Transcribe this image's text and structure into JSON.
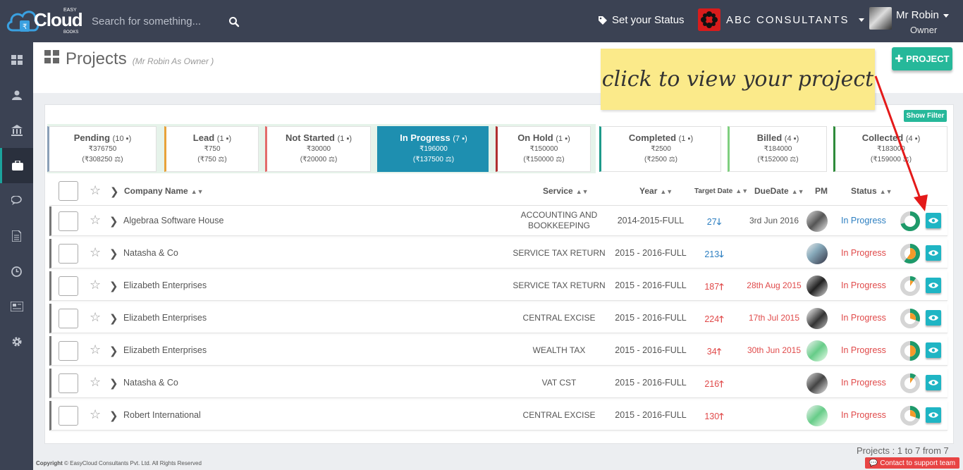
{
  "brand": {
    "logo_text": "Cloud",
    "logo_top": "EASY",
    "logo_bottom": "BOOKS"
  },
  "search": {
    "placeholder": "Search for something..."
  },
  "topbar": {
    "status_label": "Set your Status",
    "company": "ABC CONSULTANTS",
    "user_name": "Mr Robin",
    "user_role": "Owner"
  },
  "sidebar": {
    "items": [
      "dashboard-icon",
      "user-icon",
      "bank-icon",
      "briefcase-icon",
      "chat-icon",
      "document-icon",
      "clock-icon",
      "news-icon",
      "gear-icon"
    ],
    "active_index": 3
  },
  "page": {
    "title": "Projects",
    "subtitle": "(Mr Robin As Owner )",
    "add_label": "PROJECT",
    "show_filter": "Show Filter"
  },
  "status_tabs": [
    {
      "name": "Pending",
      "count": "10",
      "amount": "₹376750",
      "sub": "(₹308250",
      "color": "#8aa0b8"
    },
    {
      "name": "Lead",
      "count": "1",
      "amount": "₹750",
      "sub": "(₹750",
      "color": "#e8a23a"
    },
    {
      "name": "Not Started",
      "count": "1",
      "amount": "₹30000",
      "sub": "(₹20000",
      "color": "#e36b6b"
    },
    {
      "name": "In Progress",
      "count": "7",
      "amount": "₹196000",
      "sub": "(₹137500",
      "color": "#1e8fb0",
      "active": true
    },
    {
      "name": "On Hold",
      "count": "1",
      "amount": "₹150000",
      "sub": "(₹150000",
      "color": "#b03030"
    },
    {
      "name": "Completed",
      "count": "1",
      "amount": "₹2500",
      "sub": "(₹2500",
      "color": "#1e9a8a"
    },
    {
      "name": "Billed",
      "count": "4",
      "amount": "₹184000",
      "sub": "(₹152000",
      "color": "#7fcf7f"
    },
    {
      "name": "Collected",
      "count": "4",
      "amount": "₹183000",
      "sub": "(₹159000",
      "color": "#2e8b3a"
    }
  ],
  "table": {
    "headers": {
      "company": "Company Name",
      "service": "Service",
      "year": "Year",
      "target": "Target Date",
      "due": "DueDate",
      "pm": "PM",
      "status": "Status"
    },
    "rows": [
      {
        "company": "Algebraa Software House",
        "service": "ACCOUNTING AND BOOKKEEPING",
        "year": "2014-2015-FULL",
        "target": "27",
        "target_dir": "down",
        "due": "3rd Jun 2016",
        "due_red": false,
        "status": "In Progress",
        "status_color": "blue",
        "progress": 0.7
      },
      {
        "company": "Natasha & Co",
        "service": "SERVICE TAX RETURN",
        "year": "2015 - 2016-FULL",
        "target": "213",
        "target_dir": "down",
        "due": "",
        "due_red": false,
        "status": "In Progress",
        "status_color": "red",
        "progress": 0.6
      },
      {
        "company": "Elizabeth Enterprises",
        "service": "SERVICE TAX RETURN",
        "year": "2015 - 2016-FULL",
        "target": "187",
        "target_dir": "up",
        "due": "28th Aug 2015",
        "due_red": true,
        "status": "In Progress",
        "status_color": "red",
        "progress": 0.1
      },
      {
        "company": "Elizabeth Enterprises",
        "service": "CENTRAL EXCISE",
        "year": "2015 - 2016-FULL",
        "target": "224",
        "target_dir": "up",
        "due": "17th Jul 2015",
        "due_red": true,
        "status": "In Progress",
        "status_color": "red",
        "progress": 0.3
      },
      {
        "company": "Elizabeth Enterprises",
        "service": "WEALTH TAX",
        "year": "2015 - 2016-FULL",
        "target": "34",
        "target_dir": "up",
        "due": "30th Jun 2015",
        "due_red": true,
        "status": "In Progress",
        "status_color": "red",
        "progress": 0.5
      },
      {
        "company": "Natasha & Co",
        "service": "VAT CST",
        "year": "2015 - 2016-FULL",
        "target": "216",
        "target_dir": "up",
        "due": "",
        "due_red": false,
        "status": "In Progress",
        "status_color": "red",
        "progress": 0.1
      },
      {
        "company": "Robert International",
        "service": "CENTRAL EXCISE",
        "year": "2015 - 2016-FULL",
        "target": "130",
        "target_dir": "up",
        "due": "",
        "due_red": false,
        "status": "In Progress",
        "status_color": "red",
        "progress": 0.3
      }
    ]
  },
  "footer": {
    "count_text": "Projects : 1 to 7 from 7",
    "copyright_bold": "Copyright",
    "copyright": "© EasyCloud Consultants Pvt. Ltd. All Rights Reserved",
    "support": "Contact to support team"
  },
  "annotation": {
    "text": "click to view your project"
  },
  "colors": {
    "accent": "#26b89a",
    "sidebar": "#3b4253",
    "eye": "#1fb5c4",
    "red": "#e04a4a",
    "blue": "#2d7fc1"
  }
}
